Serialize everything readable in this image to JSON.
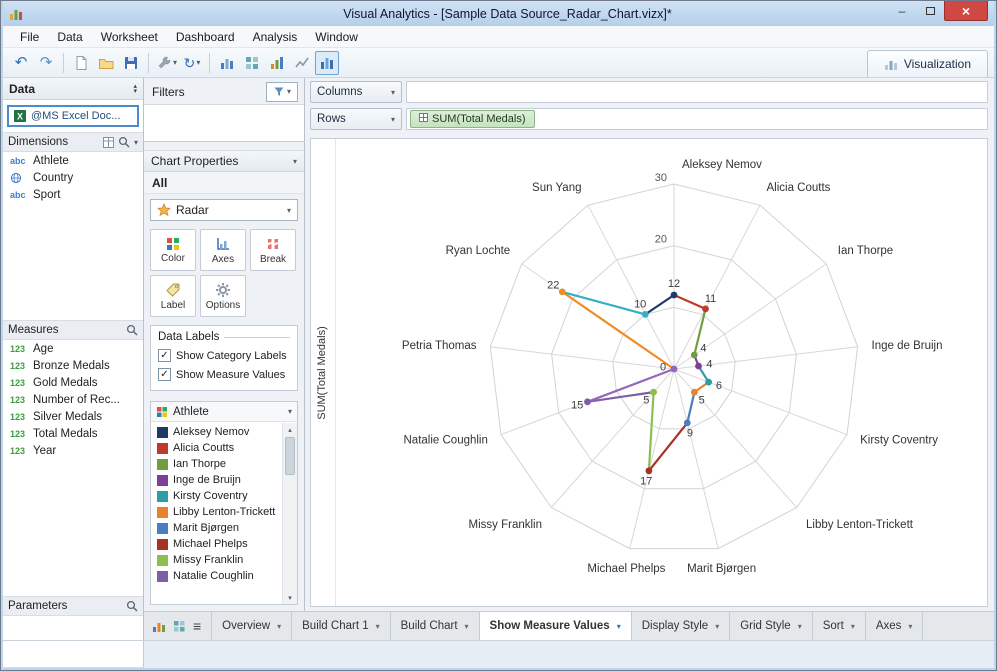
{
  "window": {
    "title": "Visual Analytics - [Sample Data Source_Radar_Chart.vizx]*"
  },
  "icons": {
    "minimize": "–",
    "close": "×",
    "chevron_down": "▾",
    "chevron_up": "▴",
    "undo": "↶",
    "redo": "↷",
    "refresh": "↻",
    "hamburger": "≡",
    "check": "✓"
  },
  "menu": {
    "items": [
      "File",
      "Data",
      "Worksheet",
      "Dashboard",
      "Analysis",
      "Window"
    ]
  },
  "toolbar": {
    "visualization_label": "Visualization"
  },
  "sidebar": {
    "data_header": "Data",
    "data_source": "@MS Excel Doc...",
    "dimensions": {
      "header": "Dimensions",
      "items": [
        {
          "icon": "abc",
          "label": "Athlete"
        },
        {
          "icon": "globe",
          "label": "Country"
        },
        {
          "icon": "abc",
          "label": "Sport"
        }
      ]
    },
    "measures": {
      "header": "Measures",
      "items": [
        {
          "icon": "123",
          "label": "Age"
        },
        {
          "icon": "123",
          "label": "Bronze Medals"
        },
        {
          "icon": "123",
          "label": "Gold Medals"
        },
        {
          "icon": "123",
          "label": "Number of Rec..."
        },
        {
          "icon": "123",
          "label": "Silver Medals"
        },
        {
          "icon": "123",
          "label": "Total Medals"
        },
        {
          "icon": "123",
          "label": "Year"
        }
      ]
    },
    "parameters_header": "Parameters"
  },
  "properties_panel": {
    "filters_label": "Filters",
    "chart_properties_label": "Chart Properties",
    "scope_label": "All",
    "chart_type": "Radar",
    "buttons": {
      "color": "Color",
      "axes": "Axes",
      "break": "Break",
      "label": "Label",
      "options": "Options"
    },
    "data_labels": {
      "title": "Data Labels",
      "checkboxes": [
        {
          "label": "Show Category Labels",
          "checked": true
        },
        {
          "label": "Show Measure Values",
          "checked": true
        }
      ]
    },
    "legend": {
      "title": "Athlete",
      "items": [
        {
          "color": "#1f3a64",
          "label": "Aleksey Nemov"
        },
        {
          "color": "#c0392b",
          "label": "Alicia Coutts"
        },
        {
          "color": "#6f9d40",
          "label": "Ian Thorpe"
        },
        {
          "color": "#7d3f98",
          "label": "Inge de Bruijn"
        },
        {
          "color": "#2e9daa",
          "label": "Kirsty Coventry"
        },
        {
          "color": "#e8832c",
          "label": "Libby Lenton-Trickett"
        },
        {
          "color": "#4a7dc4",
          "label": "Marit Bjørgen"
        },
        {
          "color": "#a93128",
          "label": "Michael Phelps"
        },
        {
          "color": "#8cbf50",
          "label": "Missy Franklin"
        },
        {
          "color": "#7e5fa5",
          "label": "Natalie Coughlin"
        }
      ]
    }
  },
  "shelves": {
    "columns_label": "Columns",
    "rows_label": "Rows",
    "rows_pills": [
      "SUM(Total Medals)"
    ]
  },
  "chart_data": {
    "type": "radar",
    "axis_label": "SUM(Total Medals)",
    "max": 30,
    "rings": [
      10,
      20,
      30
    ],
    "tick_labels": [
      30,
      20
    ],
    "start": "top",
    "direction": "clockwise",
    "categories": [
      "Aleksey Nemov",
      "Alicia Coutts",
      "Ian Thorpe",
      "Inge de Bruijn",
      "Kirsty Coventry",
      "Libby Lenton-Trickett",
      "Marit Bjørgen",
      "Michael Phelps",
      "Missy Franklin",
      "Natalie Coughlin",
      "Petria Thomas",
      "Ryan Lochte",
      "Sun Yang"
    ],
    "series": [
      {
        "name": "SUM(Total Medals)",
        "values": [
          12,
          11,
          4,
          4,
          6,
          5,
          9,
          17,
          5,
          15,
          0,
          22,
          10
        ]
      }
    ],
    "colors": [
      "#1f3a64",
      "#c0392b",
      "#6f9d40",
      "#7d3f98",
      "#2e9daa",
      "#e8832c",
      "#4a7dc4",
      "#a93128",
      "#8cbf50",
      "#7e5fa5",
      "#9467bd",
      "#ef8c22",
      "#35aec6"
    ]
  },
  "bottom_tabs": {
    "tabs": [
      {
        "label": "Overview"
      },
      {
        "label": "Build Chart 1"
      },
      {
        "label": "Build Chart"
      },
      {
        "label": "Show Measure Values",
        "active": true
      },
      {
        "label": "Display Style"
      },
      {
        "label": "Grid Style"
      },
      {
        "label": "Sort"
      },
      {
        "label": "Axes"
      }
    ]
  }
}
